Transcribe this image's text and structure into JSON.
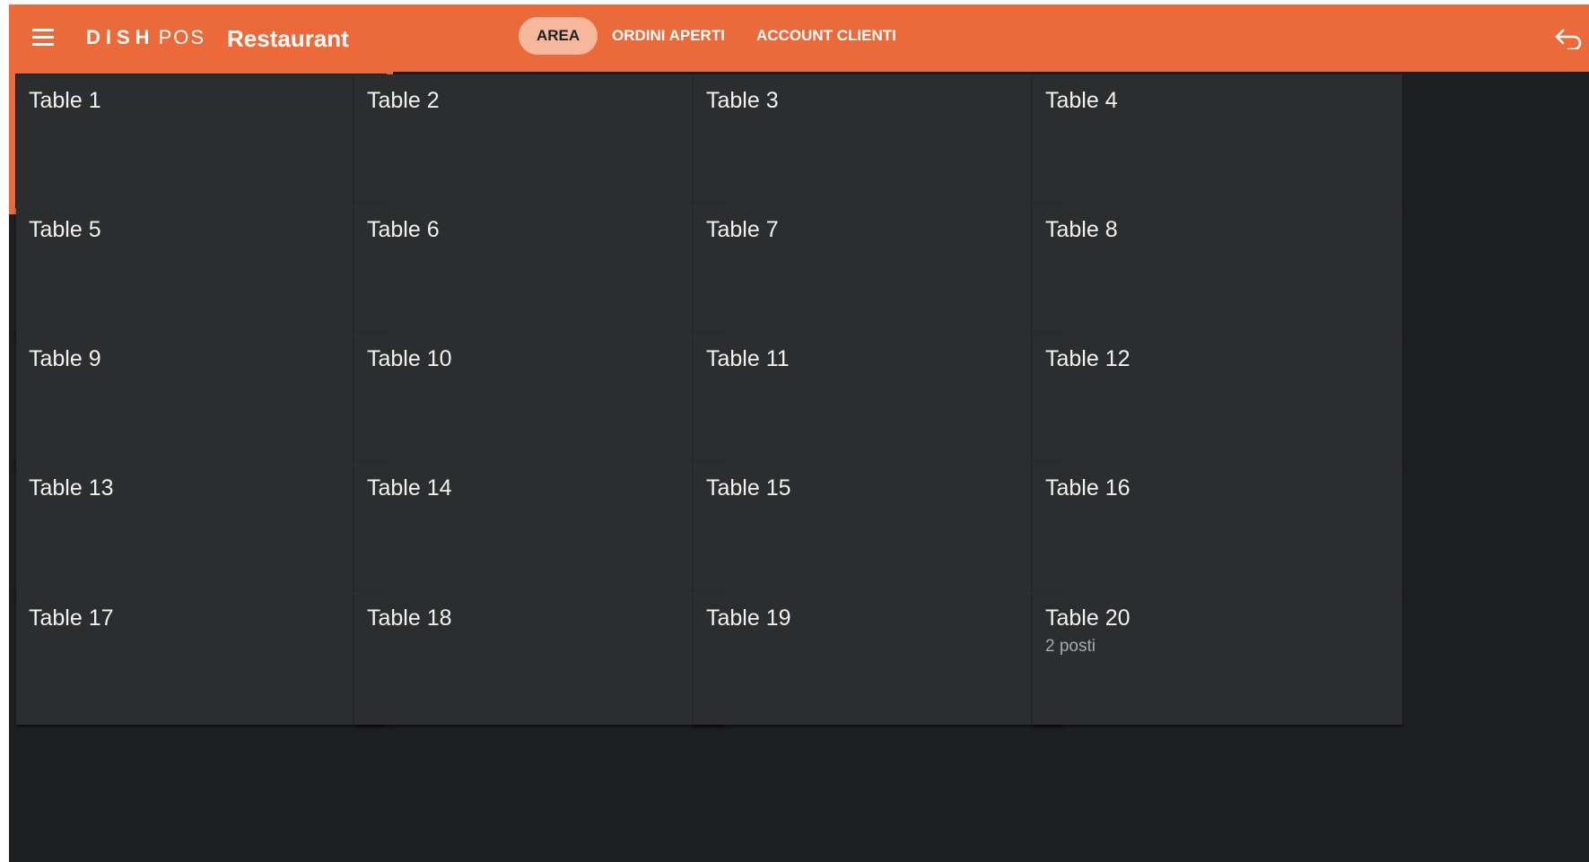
{
  "header": {
    "menu_icon": "hamburger-menu-icon",
    "logo_part1": "DISH",
    "logo_part2": "POS",
    "venue": "Restaurant",
    "tabs": [
      {
        "label": "AREA",
        "active": true
      },
      {
        "label": "ORDINI APERTI",
        "active": false
      },
      {
        "label": "ACCOUNT CLIENTI",
        "active": false
      }
    ],
    "back_icon": "back-arrow-icon",
    "background_color": "#ec6a3a",
    "active_tab_color": "#f5b89c"
  },
  "tables": [
    {
      "name": "Table 1",
      "seats": "",
      "selected": true
    },
    {
      "name": "Table 2",
      "seats": ""
    },
    {
      "name": "Table 3",
      "seats": ""
    },
    {
      "name": "Table 4",
      "seats": ""
    },
    {
      "name": "Table 5",
      "seats": ""
    },
    {
      "name": "Table 6",
      "seats": ""
    },
    {
      "name": "Table 7",
      "seats": ""
    },
    {
      "name": "Table 8",
      "seats": ""
    },
    {
      "name": "Table 9",
      "seats": ""
    },
    {
      "name": "Table 10",
      "seats": ""
    },
    {
      "name": "Table 11",
      "seats": ""
    },
    {
      "name": "Table 12",
      "seats": ""
    },
    {
      "name": "Table 13",
      "seats": ""
    },
    {
      "name": "Table 14",
      "seats": ""
    },
    {
      "name": "Table 15",
      "seats": ""
    },
    {
      "name": "Table 16",
      "seats": ""
    },
    {
      "name": "Table 17",
      "seats": ""
    },
    {
      "name": "Table 18",
      "seats": ""
    },
    {
      "name": "Table 19",
      "seats": ""
    },
    {
      "name": "Table 20",
      "seats": "2 posti"
    }
  ],
  "colors": {
    "accent": "#ec6a3a",
    "card_background": "#2b2d2f",
    "app_background": "#1e1f21"
  }
}
